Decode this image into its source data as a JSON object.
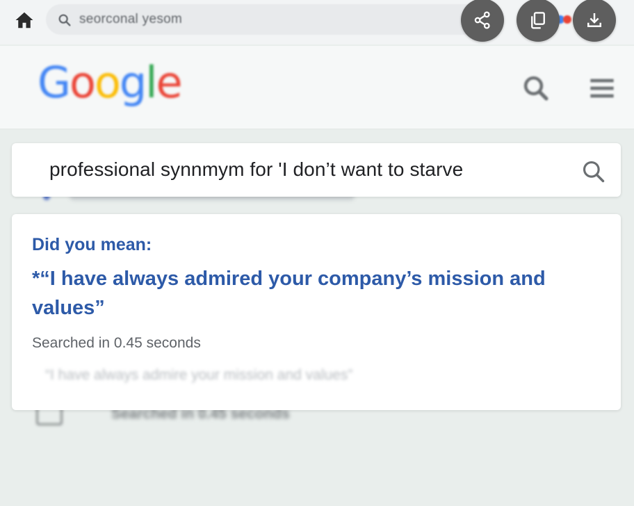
{
  "browser": {
    "address_text": "seorconal yesom",
    "brand_dot_colors": [
      "#4285f4",
      "#ea4335"
    ],
    "tab_close_glyph": "×"
  },
  "actions": {
    "share": "share-icon",
    "copy": "copy-icon",
    "download": "download-icon"
  },
  "header": {
    "logo": [
      {
        "ch": "G",
        "color": "#4285F4"
      },
      {
        "ch": "o",
        "color": "#EA4335"
      },
      {
        "ch": "o",
        "color": "#FBBC05"
      },
      {
        "ch": "g",
        "color": "#4285F4"
      },
      {
        "ch": "l",
        "color": "#34A853"
      },
      {
        "ch": "e",
        "color": "#EA4335"
      }
    ]
  },
  "search": {
    "query": "professional synnmym for 'I don’t want to starve"
  },
  "result": {
    "did_you_mean_label": "Did you mean:",
    "suggestion": "*“I have always admired your company’s mission and values”",
    "search_time": "Searched in 0.45 seconds",
    "faded_snippet": "“I have always admire your mission and values”"
  },
  "background": {
    "secondary_text": "Searched in 0.45 seconds"
  },
  "colors": {
    "link_blue": "#2d5aa8",
    "fab_gray": "#5e5e5e",
    "page_bg": "#e9eeec"
  }
}
